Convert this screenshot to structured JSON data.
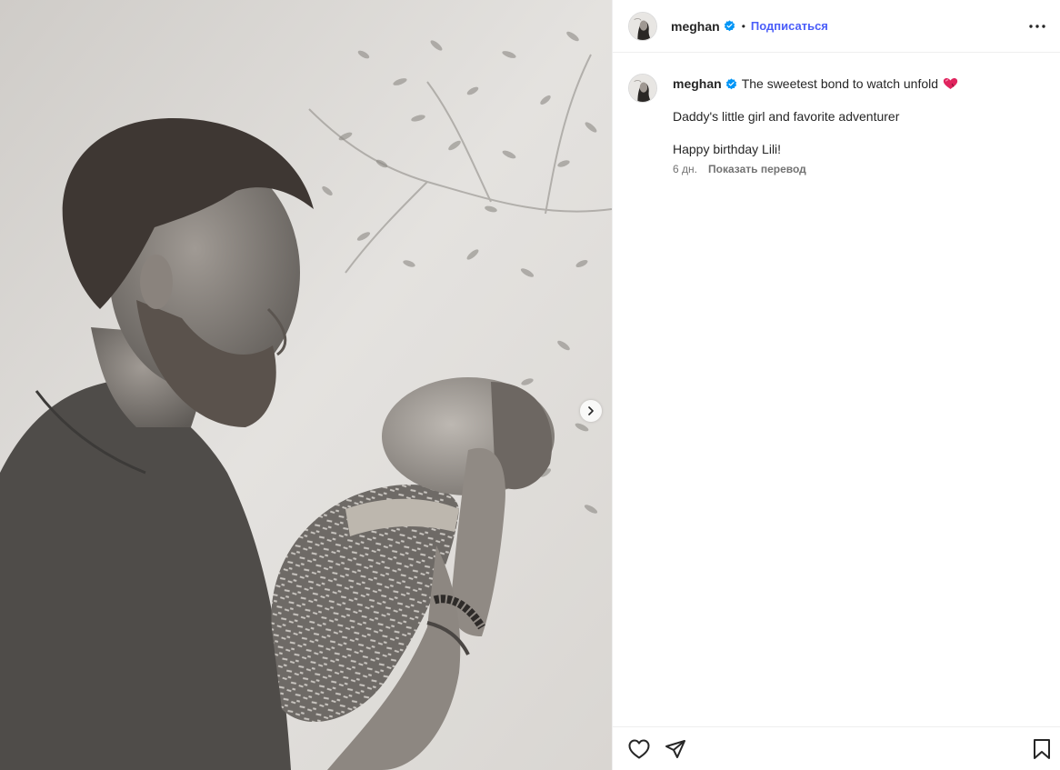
{
  "post": {
    "username": "meghan",
    "follow_label": "Подписаться",
    "dot": "•",
    "caption": {
      "first_line": "The sweetest bond to watch unfold",
      "paragraphs": [
        "Daddy's little girl and favorite adventurer",
        "Happy birthday Lili!"
      ],
      "time_ago": "6 дн.",
      "translate_label": "Показать перевод"
    }
  },
  "icons": {
    "verified": "verified-badge-icon",
    "more": "more-options-icon",
    "next": "chevron-right-icon",
    "like": "heart-icon",
    "share": "paper-plane-icon",
    "save": "bookmark-icon",
    "emoji": "red-heart-emoji-icon"
  },
  "colors": {
    "accent": "#4a5df9",
    "verified": "#0095f6",
    "text": "#262626",
    "muted": "#737373",
    "heart_emoji": "#e0245e"
  }
}
